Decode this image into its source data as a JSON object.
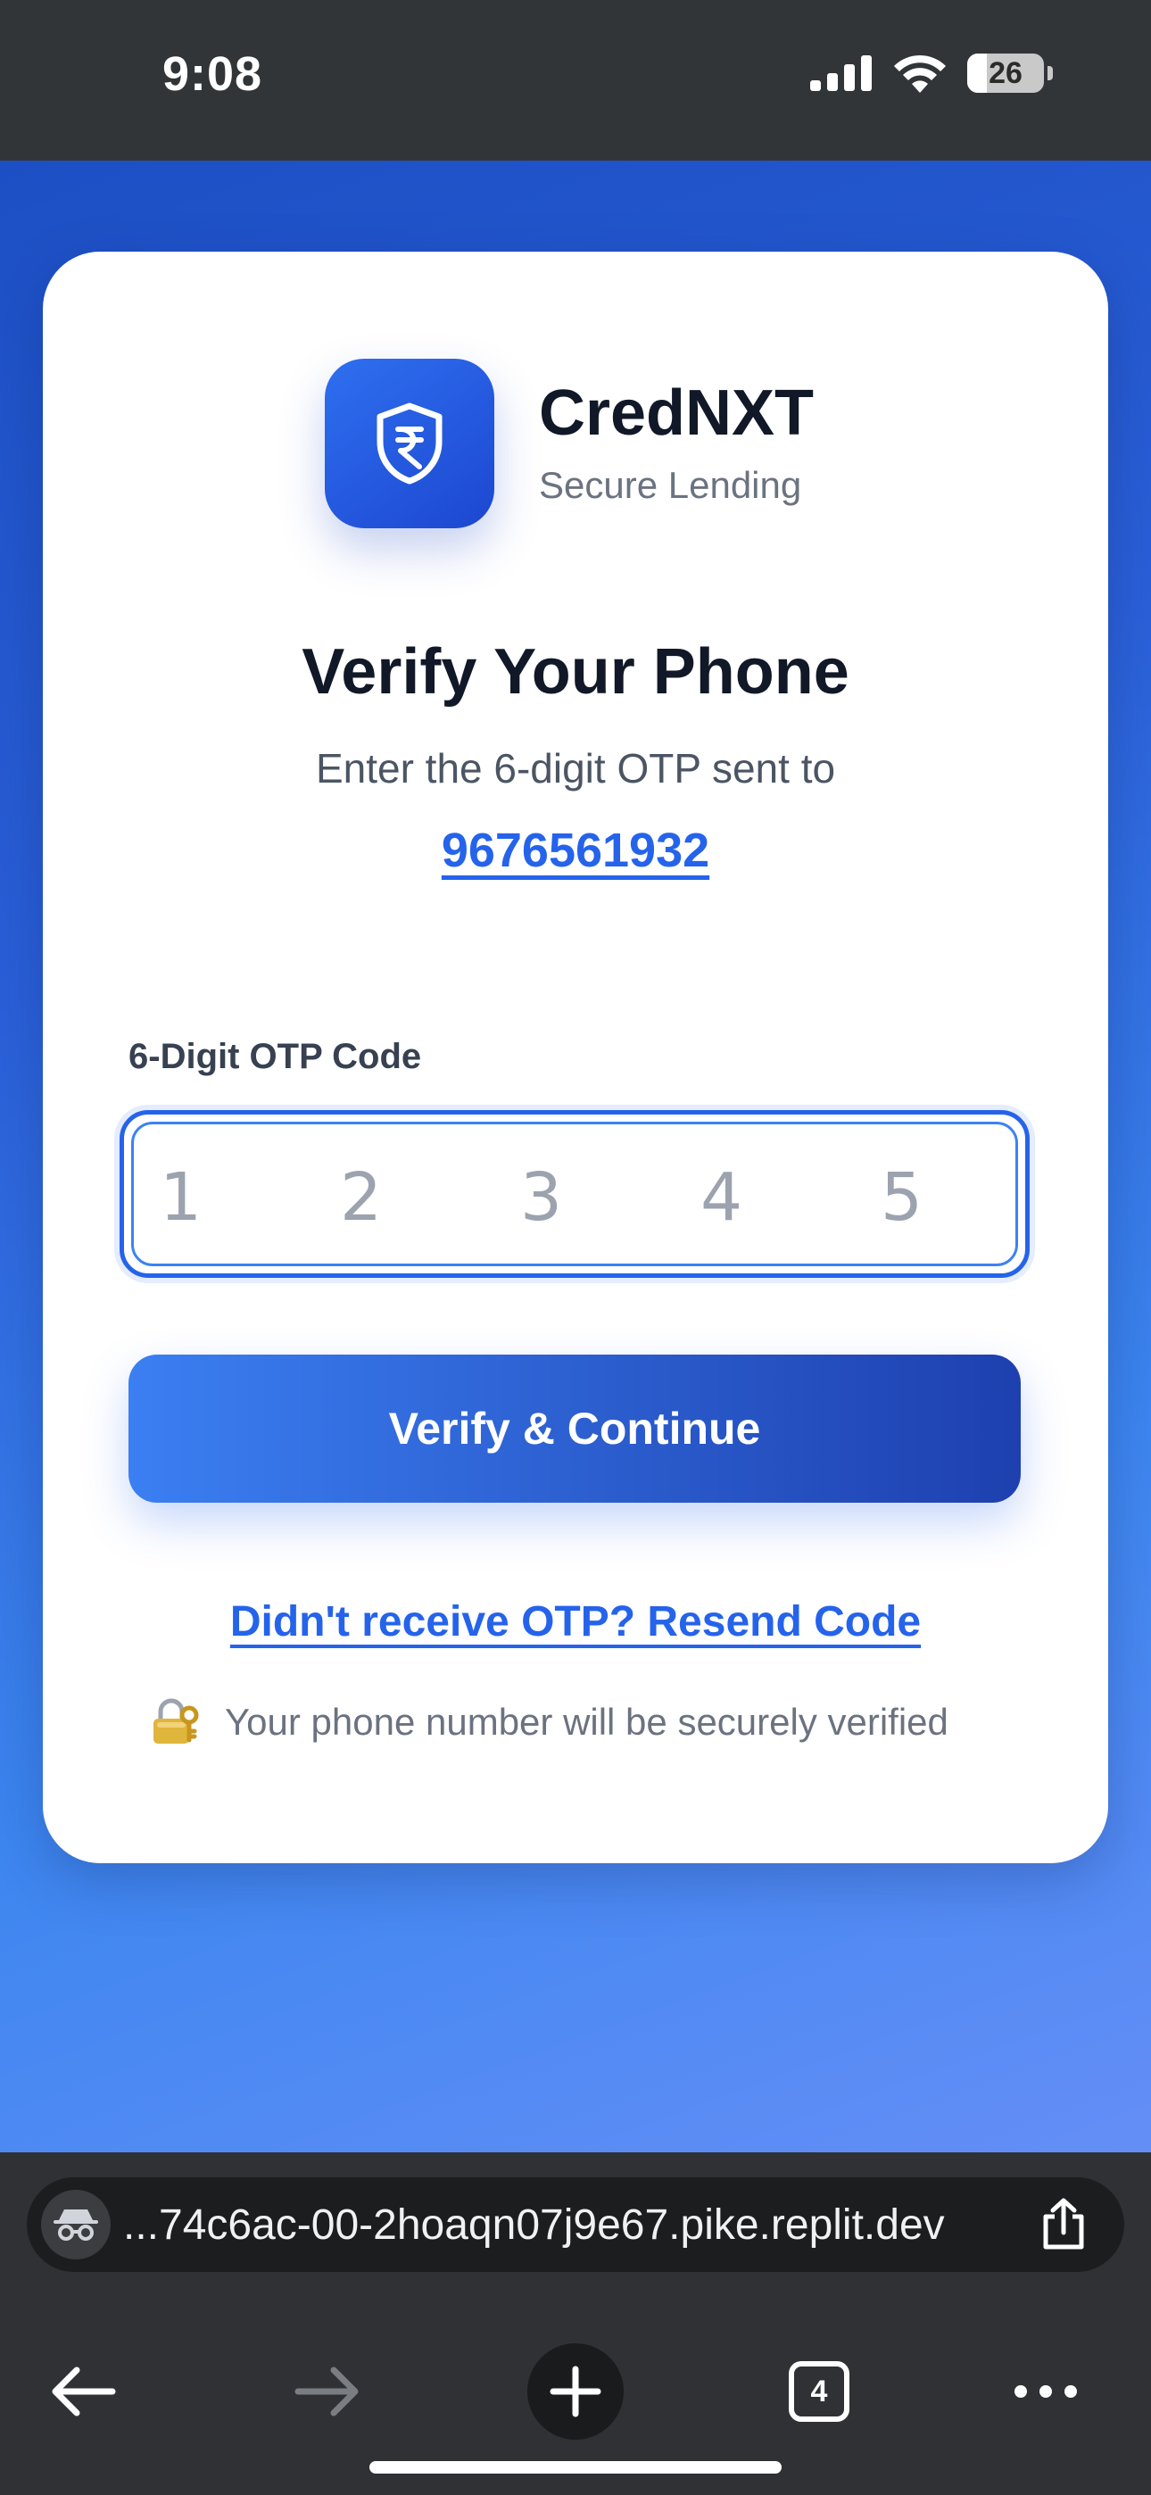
{
  "status_bar": {
    "time": "9:08",
    "battery": "26",
    "battery_level": 0.26
  },
  "app": {
    "name": "CredNXT",
    "tagline": "Secure Lending"
  },
  "verify": {
    "title": "Verify Your Phone",
    "subtitle": "Enter the 6-digit OTP sent to",
    "phone": "9676561932",
    "otp_label": "6-Digit OTP Code",
    "otp_placeholder_digits": [
      "1",
      "2",
      "3",
      "4",
      "5"
    ],
    "button_label": "Verify & Continue",
    "resend_label": "Didn't receive OTP? Resend Code",
    "security_note": "Your phone number will be securely verified"
  },
  "browser": {
    "url": "...74c6ac-00-2hoaqn07j9e67.pike.replit.dev",
    "tab_count": "4"
  },
  "colors": {
    "accent": "#2563eb",
    "button_start": "#3b7ff2",
    "button_end": "#1e40af",
    "title": "#111827",
    "muted": "#6b7280"
  },
  "icons": {
    "logo": "shield-rupee-icon",
    "security": "lock-key-icon",
    "incognito": "incognito-icon",
    "share": "share-icon",
    "back": "arrow-left-icon",
    "forward": "arrow-right-icon",
    "new_tab": "plus-icon",
    "tabs": "tabs-icon",
    "menu": "more-icon"
  }
}
